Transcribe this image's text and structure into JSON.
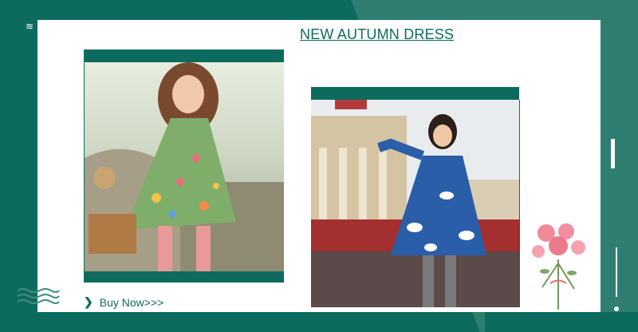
{
  "banner": {
    "title": "NEW AUTUMN DRESS",
    "cta_label": "Buy Now>>>"
  },
  "colors": {
    "brand_green": "#0d6b5e",
    "accent_green": "#2e7e72",
    "panel": "#ffffff"
  },
  "icons": [
    "chevron-right-icon",
    "wave-icon",
    "flower-bouquet-icon"
  ]
}
